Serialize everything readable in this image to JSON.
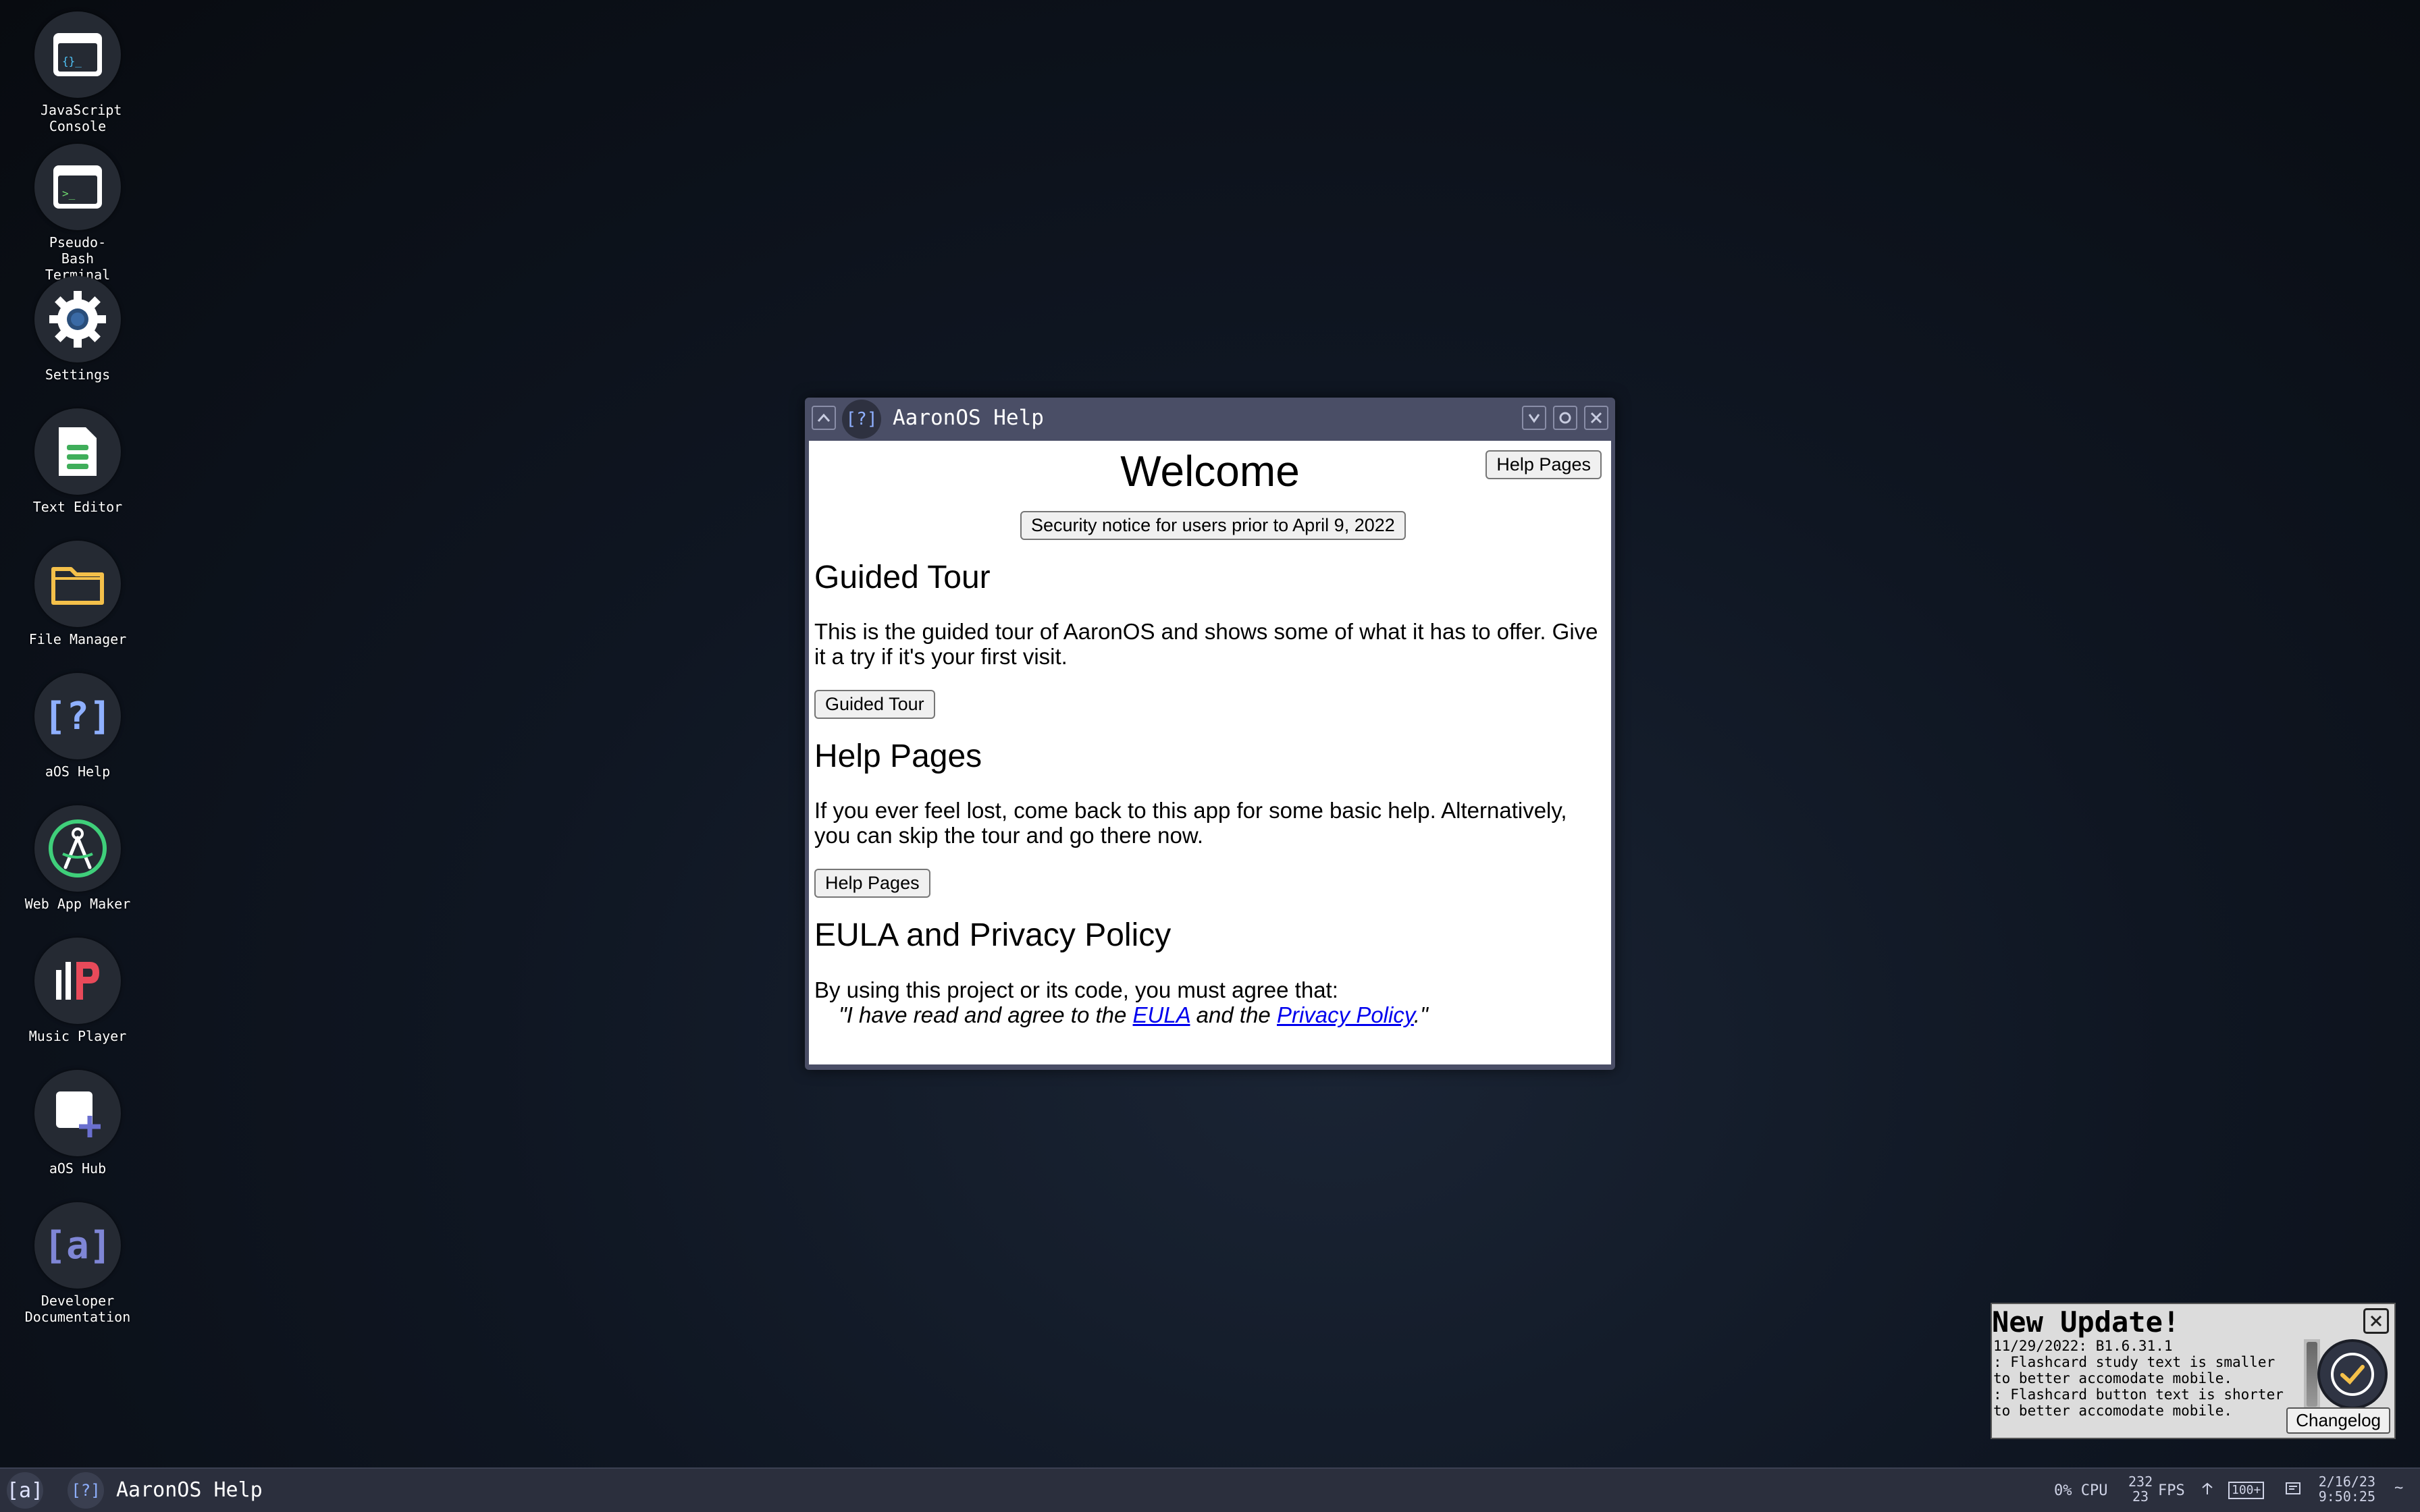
{
  "desktop": {
    "icons": [
      {
        "label": "JavaScript Console",
        "icon": "js-console-icon"
      },
      {
        "label": "Pseudo-Bash Terminal",
        "icon": "terminal-icon"
      },
      {
        "label": "Settings",
        "icon": "gear-icon"
      },
      {
        "label": "Text Editor",
        "icon": "text-editor-icon"
      },
      {
        "label": "File Manager",
        "icon": "folder-icon"
      },
      {
        "label": "aOS Help",
        "icon": "help-icon"
      },
      {
        "label": "Web App Maker",
        "icon": "web-app-maker-icon"
      },
      {
        "label": "Music Player",
        "icon": "music-player-icon"
      },
      {
        "label": "aOS Hub",
        "icon": "hub-icon"
      },
      {
        "label": "Developer Documentation",
        "icon": "aos-logo-icon"
      }
    ]
  },
  "window": {
    "title": "AaronOS Help",
    "app_icon_text": "[?]",
    "controls": {
      "up": "^",
      "minimize": "v",
      "maximize": "o",
      "close": "x"
    },
    "content": {
      "heading": "Welcome",
      "help_pages_top_button": "Help Pages",
      "security_notice_button": "Security notice for users prior to April 9, 2022",
      "guided_tour_heading": "Guided Tour",
      "guided_tour_text": "This is the guided tour of AaronOS and shows some of what it has to offer. Give it a try if it's your first visit.",
      "guided_tour_button": "Guided Tour",
      "help_pages_heading": "Help Pages",
      "help_pages_text": "If you ever feel lost, come back to this app for some basic help. Alternatively, you can skip the tour and go there now.",
      "help_pages_button": "Help Pages",
      "eula_heading": "EULA and Privacy Policy",
      "eula_text": "By using this project or its code, you must agree that:",
      "eula_quote_prefix": "\"I have read and agree to the ",
      "eula_link": "EULA",
      "eula_quote_middle": " and the ",
      "privacy_link": "Privacy Policy",
      "eula_quote_suffix": ".\""
    }
  },
  "notification": {
    "title": "New Update!",
    "lines": [
      "11/29/2022: B1.6.31.1",
      ": Flashcard study text is smaller to better accomodate mobile.",
      ": Flashcard button text is shorter to better accomodate mobile."
    ],
    "changelog_button": "Changelog",
    "close": "x"
  },
  "taskbar": {
    "start_icon_text": "[a]",
    "task_icon_text": "[?]",
    "task_label": "AaronOS Help",
    "cpu": "0% CPU",
    "fps_top": "232",
    "fps_bottom": "23",
    "fps_label": "FPS",
    "battery": "100+",
    "date": "2/16/23",
    "time": "9:50:25",
    "tilde": "~"
  }
}
